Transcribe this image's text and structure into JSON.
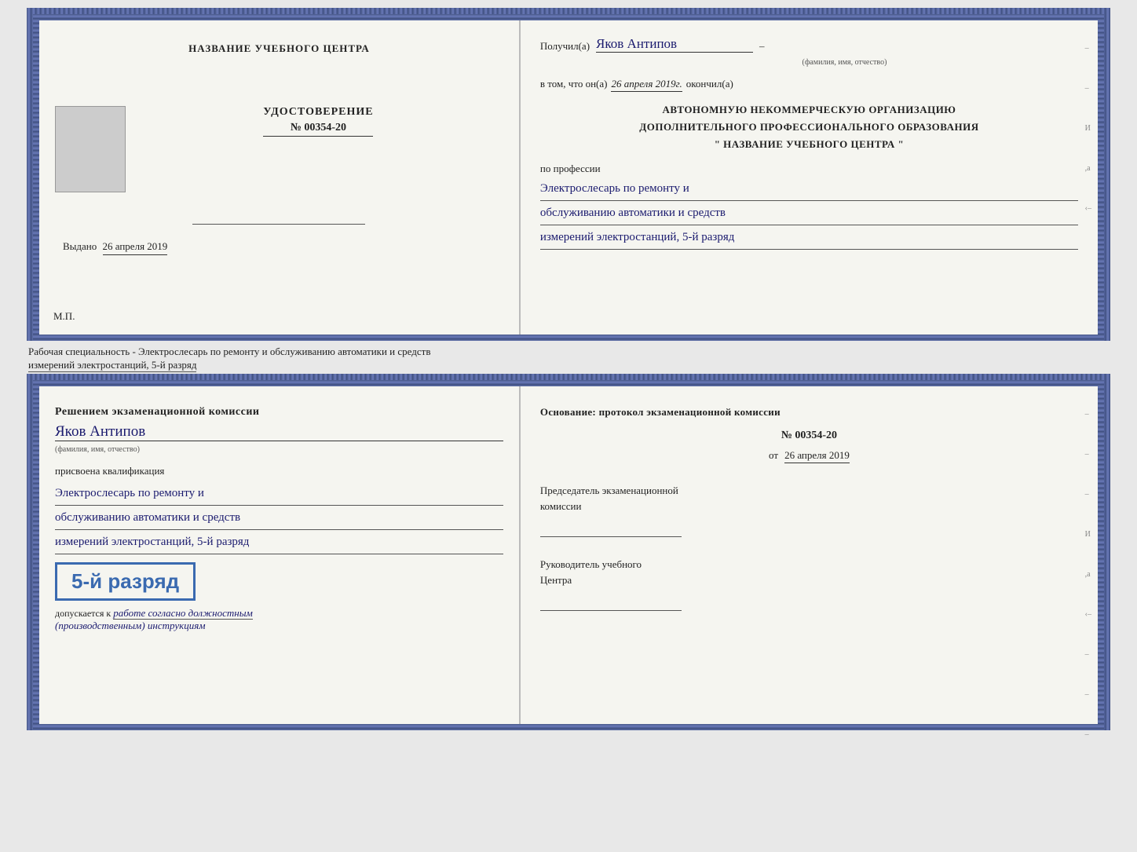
{
  "top_book": {
    "left_page": {
      "title": "НАЗВАНИЕ УЧЕБНОГО ЦЕНТРА",
      "udostoverenie_label": "УДОСТОВЕРЕНИЕ",
      "number": "№ 00354-20",
      "vydano_prefix": "Выдано",
      "vydano_date": "26 апреля 2019",
      "mp_label": "М.П."
    },
    "right_page": {
      "poluchil_prefix": "Получил(а)",
      "fio_handwritten": "Яков Антипов",
      "fio_hint": "(фамилия, имя, отчество)",
      "v_tom_prefix": "в том, что он(а)",
      "v_tom_date": "26 апреля 2019г.",
      "okonchil": "окончил(а)",
      "autonomnaya_line1": "АВТОНОМНУЮ НЕКОММЕРЧЕСКУЮ ОРГАНИЗАЦИЮ",
      "autonomnaya_line2": "ДОПОЛНИТЕЛЬНОГО ПРОФЕССИОНАЛЬНОГО ОБРАЗОВАНИЯ",
      "autonomnaya_line3": "\"  НАЗВАНИЕ УЧЕБНОГО ЦЕНТРА  \"",
      "po_professii": "по профессии",
      "profession_line1": "Электрослесарь по ремонту и",
      "profession_line2": "обслуживанию автоматики и средств",
      "profession_line3": "измерений электростанций, 5-й разряд"
    }
  },
  "between": {
    "text": "Рабочая специальность - Электрослесарь по ремонту и обслуживанию автоматики и средств",
    "text2": "измерений электростанций, 5-й разряд"
  },
  "bottom_book": {
    "left_page": {
      "resheniem": "Решением экзаменационной комиссии",
      "fio_handwritten": "Яков Антипов",
      "fio_hint": "(фамилия, имя, отчество)",
      "prisvoena": "присвоена квалификация",
      "profession_line1": "Электрослесарь по ремонту и",
      "profession_line2": "обслуживанию автоматики и средств",
      "profession_line3": "измерений электростанций, 5-й разряд",
      "badge_text": "5-й разряд",
      "dopuskaetsya_prefix": "допускается к",
      "dopuskaetsya_text": "работе согласно должностным",
      "dopuskaetsya_text2": "(производственным) инструкциям"
    },
    "right_page": {
      "osnovanie_label": "Основание: протокол экзаменационной комиссии",
      "protocol_number": "№  00354-20",
      "ot_prefix": "от",
      "ot_date": "26 апреля 2019",
      "predsedatel_label": "Председатель экзаменационной",
      "predsedatel_label2": "комиссии",
      "rukovoditel_label": "Руководитель учебного",
      "rukovoditel_label2": "Центра"
    }
  }
}
